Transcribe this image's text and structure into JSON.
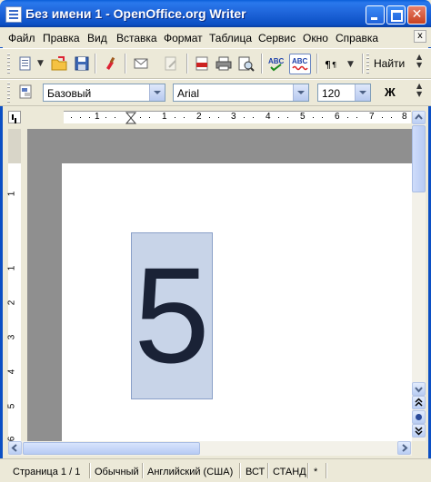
{
  "window": {
    "title": "Без имени 1 - OpenOffice.org Writer",
    "close_glyph": "✕"
  },
  "menu": {
    "items": [
      "Файл",
      "Правка",
      "Вид",
      "Вставка",
      "Формат",
      "Таблица",
      "Сервис",
      "Окно",
      "Справка"
    ],
    "close_glyph": "x"
  },
  "toolbar_standard": {
    "find_label": "Найти",
    "icons": [
      "new-document-icon",
      "dropdown-arrow-icon",
      "open-folder-icon",
      "save-icon",
      "edit-brush-icon",
      "email-icon",
      "edit-file-icon",
      "export-pdf-icon",
      "print-icon",
      "print-preview-icon",
      "spellcheck-icon",
      "auto-spellcheck-icon",
      "nonprinting-characters-icon"
    ]
  },
  "toolbar_format": {
    "style_value": "Базовый",
    "font_value": "Arial",
    "size_value": "120",
    "bold_label": "Ж"
  },
  "ruler": {
    "h_numbers": [
      "1",
      "1",
      "2",
      "3",
      "4",
      "5",
      "6",
      "7",
      "8"
    ],
    "v_numbers": [
      "1",
      "1",
      "2",
      "3",
      "4",
      "5",
      "6"
    ]
  },
  "document": {
    "frame_text": "5"
  },
  "status": {
    "page": "Страница  1 / 1",
    "style": "Обычный",
    "language": "Английский (США)",
    "insert_mode": "ВСТ",
    "selection_mode": "СТАНД",
    "modified": "*"
  },
  "colors": {
    "titlebar": "#0b4fc4",
    "frame_fill": "#c8d4e8",
    "doc_background": "#8f8f8f"
  }
}
